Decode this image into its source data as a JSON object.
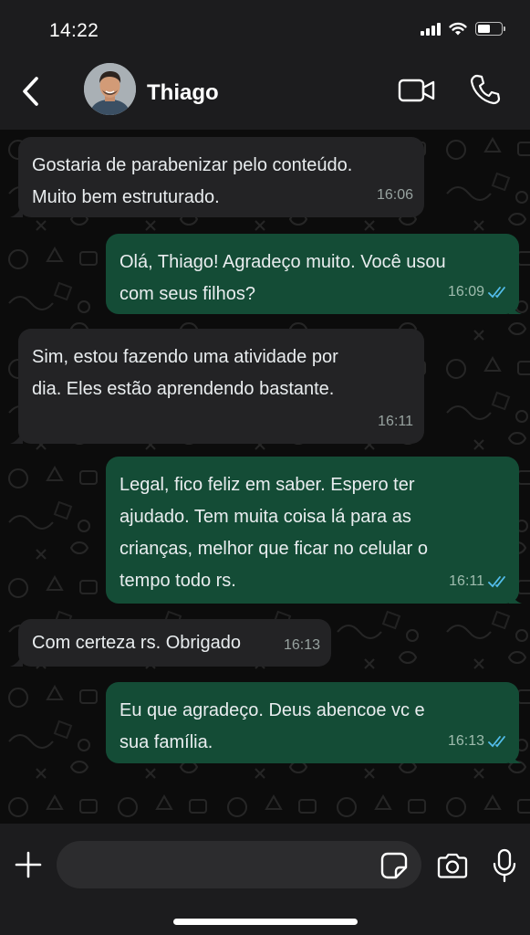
{
  "status_bar": {
    "time": "14:22",
    "icons": [
      "signal-icon",
      "wifi-icon",
      "battery-icon"
    ]
  },
  "header": {
    "contact_name": "Thiago",
    "icons": [
      "back-chevron-icon",
      "avatar",
      "video-call-icon",
      "phone-call-icon"
    ]
  },
  "messages": [
    {
      "direction": "incoming",
      "text": "Gostaria de parabenizar pelo conteúdo.\nMuito bem estruturado.",
      "time": "16:06"
    },
    {
      "direction": "outgoing",
      "text": "Olá, Thiago! Agradeço muito. Você usou\ncom seus filhos?",
      "time": "16:09",
      "status": "read"
    },
    {
      "direction": "incoming",
      "text": "Sim, estou fazendo uma atividade por\ndia. Eles estão aprendendo bastante.",
      "time": "16:11"
    },
    {
      "direction": "outgoing",
      "text": "Legal, fico feliz em saber. Espero ter\najudado. Tem muita coisa lá para as\ncrianças, melhor que ficar no celular o\ntempo todo rs.",
      "time": "16:11",
      "status": "read"
    },
    {
      "direction": "incoming",
      "text": "Com certeza rs. Obrigado",
      "time": "16:13"
    },
    {
      "direction": "outgoing",
      "text": "Eu que agradeço. Deus abencoe vc e\nsua família.",
      "time": "16:13",
      "status": "read"
    }
  ],
  "input_bar": {
    "message_value": "",
    "message_placeholder": "",
    "icons": [
      "plus-icon",
      "sticker-icon",
      "camera-icon",
      "microphone-icon"
    ]
  },
  "colors": {
    "incoming_bubble": "#232325",
    "outgoing_bubble": "#144c36",
    "read_tick": "#53bdeb",
    "bars": "#1c1c1e"
  }
}
